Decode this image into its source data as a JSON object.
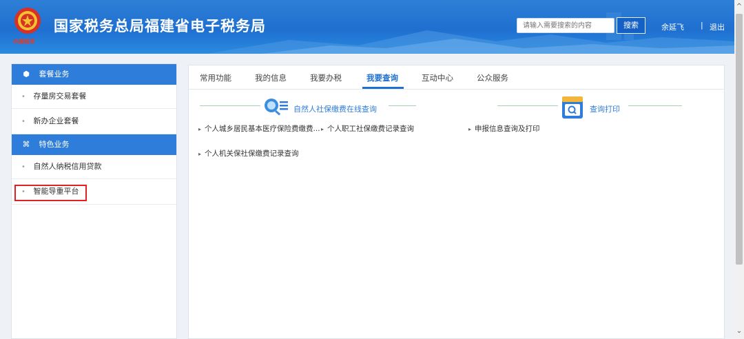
{
  "header": {
    "site_title": "国家税务总局福建省电子税务局",
    "search_placeholder": "请输入需要搜索的内容",
    "search_button": "搜索",
    "user_name": "余延飞",
    "separator": "|",
    "logout": "退出",
    "emblem_text": "中国税务"
  },
  "sidebar": {
    "groups": [
      {
        "title": "套餐业务",
        "icon": "cube-icon",
        "items": [
          {
            "label": "存量房交易套餐"
          },
          {
            "label": "新办企业套餐"
          }
        ]
      },
      {
        "title": "特色业务",
        "icon": "grid-icon",
        "items": [
          {
            "label": "自然人纳税信用贷款"
          },
          {
            "label": "智能导重平台"
          }
        ]
      }
    ]
  },
  "main": {
    "tabs": [
      {
        "label": "常用功能"
      },
      {
        "label": "我的信息"
      },
      {
        "label": "我要办税"
      },
      {
        "label": "我要查询"
      },
      {
        "label": "互动中心"
      },
      {
        "label": "公众服务"
      }
    ],
    "active_tab": "我要查询",
    "sections": [
      {
        "title": "自然人社保缴费在线查询",
        "icon": "magnify-list-icon",
        "links": [
          {
            "label": "个人城乡居民基本医疗保险费缴费..."
          },
          {
            "label": "个人职工社保缴费记录查询"
          },
          {
            "label": "个人机关保社保缴费记录查询"
          }
        ]
      },
      {
        "title": "查询打印",
        "icon": "search-print-icon",
        "links": [
          {
            "label": "申报信息查询及打印"
          }
        ]
      }
    ]
  },
  "colors": {
    "header_blue": "#1f6fd0",
    "accent_blue": "#2f7ddb",
    "highlight_red": "#e02020",
    "section_line_green": "#9fd2b0"
  }
}
